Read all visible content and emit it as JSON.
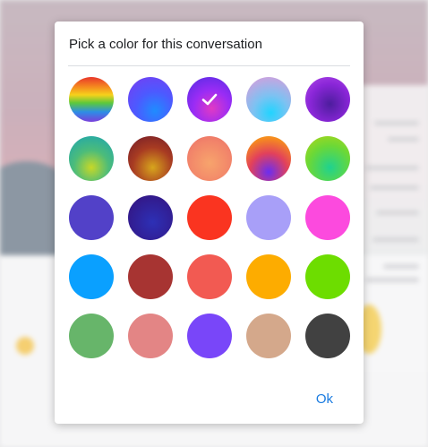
{
  "dialog": {
    "title": "Pick a color for this conversation",
    "ok_label": "Ok"
  },
  "swatches": [
    {
      "name": "rainbow",
      "colors": [
        "#e8362b",
        "#f58a1f",
        "#f6d21b",
        "#5cc93b",
        "#2e8de6",
        "#7b3fdc"
      ],
      "selected": false
    },
    {
      "name": "blue-purple-gradient",
      "colors": [
        "#1f8cff",
        "#4d59ff",
        "#7a3bf0"
      ],
      "selected": false
    },
    {
      "name": "purple-pink-gradient",
      "colors": [
        "#e13ac4",
        "#9b2cf5",
        "#4e2de2"
      ],
      "selected": true
    },
    {
      "name": "cyan-pink-gradient",
      "colors": [
        "#21d4ff",
        "#7cc2f2",
        "#e598d8"
      ],
      "selected": false
    },
    {
      "name": "violet-gradient",
      "colors": [
        "#4d1d9e",
        "#8a26d8",
        "#b44be8"
      ],
      "selected": false
    },
    {
      "name": "teal-yellow-gradient",
      "colors": [
        "#c7d827",
        "#4cbc7a",
        "#1aa3b4"
      ],
      "selected": false
    },
    {
      "name": "maroon-gold-gradient",
      "colors": [
        "#d7a51c",
        "#a83b22",
        "#6e1a2a"
      ],
      "selected": false
    },
    {
      "name": "peach-gradient",
      "colors": [
        "#f7a46c",
        "#f2856a",
        "#ea6e66"
      ],
      "selected": false
    },
    {
      "name": "fire-gradient",
      "colors": [
        "#6b2df0",
        "#e2415b",
        "#f68b1f",
        "#f1b02a"
      ],
      "selected": false
    },
    {
      "name": "lime-teal-gradient",
      "colors": [
        "#1fd28f",
        "#6cd836",
        "#b6d618"
      ],
      "selected": false
    },
    {
      "name": "indigo",
      "colors": [
        "#5241c8"
      ],
      "selected": false
    },
    {
      "name": "deep-indigo",
      "colors": [
        "#2d30b6",
        "#321a8c"
      ],
      "selected": false
    },
    {
      "name": "red",
      "colors": [
        "#fa3420"
      ],
      "selected": false
    },
    {
      "name": "lavender",
      "colors": [
        "#a89ff8"
      ],
      "selected": false
    },
    {
      "name": "magenta",
      "colors": [
        "#fc4ade"
      ],
      "selected": false
    },
    {
      "name": "sky-blue",
      "colors": [
        "#0aa0ff"
      ],
      "selected": false
    },
    {
      "name": "brick-red",
      "colors": [
        "#a73432"
      ],
      "selected": false
    },
    {
      "name": "coral",
      "colors": [
        "#f25a52"
      ],
      "selected": false
    },
    {
      "name": "amber",
      "colors": [
        "#fdac00"
      ],
      "selected": false
    },
    {
      "name": "green",
      "colors": [
        "#6ddd00"
      ],
      "selected": false
    },
    {
      "name": "sage-green",
      "colors": [
        "#67b56a"
      ],
      "selected": false
    },
    {
      "name": "dusty-rose",
      "colors": [
        "#e38585"
      ],
      "selected": false
    },
    {
      "name": "purple",
      "colors": [
        "#7946f9"
      ],
      "selected": false
    },
    {
      "name": "tan",
      "colors": [
        "#d4a88b"
      ],
      "selected": false
    },
    {
      "name": "charcoal",
      "colors": [
        "#414141"
      ],
      "selected": false
    }
  ],
  "colors": {
    "accent": "#1a7be0",
    "check": "#ffffff"
  },
  "icons": {
    "selected_indicator": "check-icon"
  }
}
